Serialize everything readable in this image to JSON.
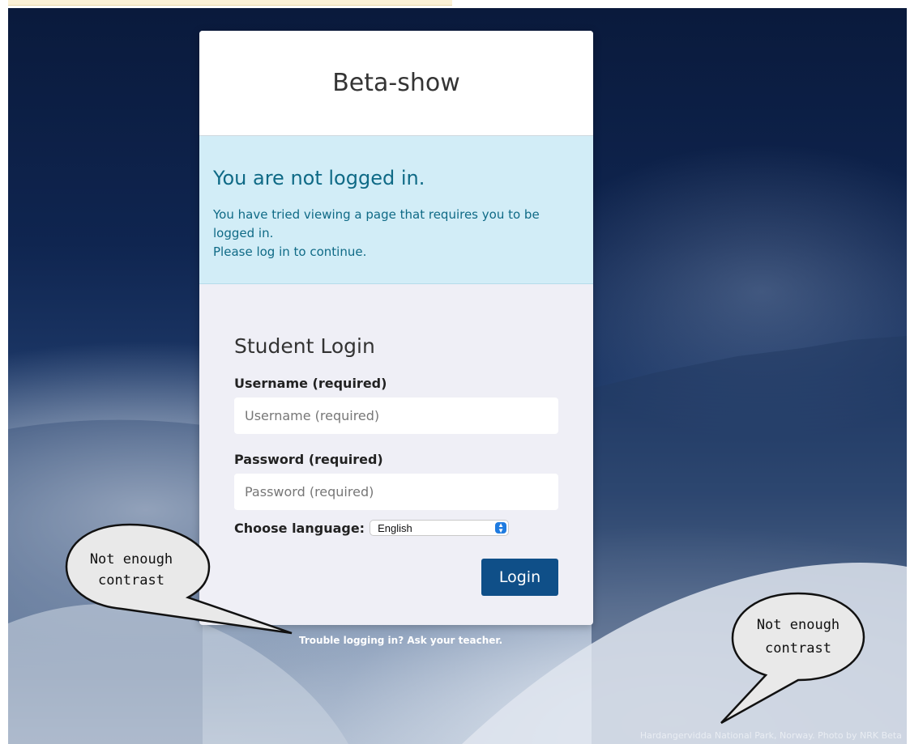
{
  "page": {
    "site_title": "Beta-show",
    "alert": {
      "title": "You are not logged in.",
      "line1": "You have tried viewing a page that requires you to be logged in.",
      "line2": "Please log in to continue."
    },
    "login": {
      "heading": "Student Login",
      "username_label": "Username (required)",
      "username_placeholder": "Username (required)",
      "password_label": "Password (required)",
      "password_placeholder": "Password (required)",
      "language_label": "Choose language:",
      "language_selected": "English",
      "button_label": "Login"
    },
    "trouble_text": "Trouble logging in? Ask your teacher.",
    "photo_credit": "Hardangervidda National Park, Norway. Photo by NRK Beta"
  },
  "annotations": {
    "bubble_left_line1": "Not enough",
    "bubble_left_line2": "contrast",
    "bubble_right_line1": "Not enough",
    "bubble_right_line2": "contrast"
  },
  "colors": {
    "alert_bg": "#d2edf7",
    "alert_text": "#0f6a86",
    "button_bg": "#0f4f88"
  }
}
